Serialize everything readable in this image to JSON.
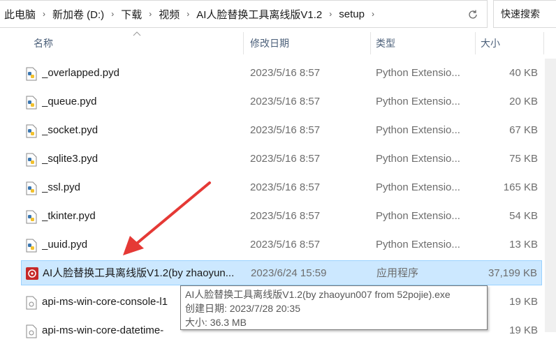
{
  "address_bar": {
    "breadcrumbs": [
      "此电脑",
      "新加卷 (D:)",
      "下载",
      "视频",
      "AI人脸替换工具离线版V1.2",
      "setup"
    ]
  },
  "search": {
    "placeholder": "快速搜索"
  },
  "columns": {
    "name": "名称",
    "date": "修改日期",
    "type": "类型",
    "size": "大小"
  },
  "files": [
    {
      "name": "_overlapped.pyd",
      "date": "2023/5/16 8:57",
      "type": "Python Extensio...",
      "size": "40 KB",
      "icon": "python-file-icon"
    },
    {
      "name": "_queue.pyd",
      "date": "2023/5/16 8:57",
      "type": "Python Extensio...",
      "size": "20 KB",
      "icon": "python-file-icon"
    },
    {
      "name": "_socket.pyd",
      "date": "2023/5/16 8:57",
      "type": "Python Extensio...",
      "size": "67 KB",
      "icon": "python-file-icon"
    },
    {
      "name": "_sqlite3.pyd",
      "date": "2023/5/16 8:57",
      "type": "Python Extensio...",
      "size": "75 KB",
      "icon": "python-file-icon"
    },
    {
      "name": "_ssl.pyd",
      "date": "2023/5/16 8:57",
      "type": "Python Extensio...",
      "size": "165 KB",
      "icon": "python-file-icon"
    },
    {
      "name": "_tkinter.pyd",
      "date": "2023/5/16 8:57",
      "type": "Python Extensio...",
      "size": "54 KB",
      "icon": "python-file-icon"
    },
    {
      "name": "_uuid.pyd",
      "date": "2023/5/16 8:57",
      "type": "Python Extensio...",
      "size": "13 KB",
      "icon": "python-file-icon"
    },
    {
      "name": "AI人脸替换工具离线版V1.2(by zhaoyun...",
      "date": "2023/6/24 15:59",
      "type": "应用程序",
      "size": "37,199 KB",
      "icon": "exe-app-icon",
      "selected": true
    },
    {
      "name": "api-ms-win-core-console-l1",
      "date": "",
      "type": "",
      "size": "19 KB",
      "icon": "dll-file-icon"
    },
    {
      "name": "api-ms-win-core-datetime-",
      "date": "",
      "type": "",
      "size": "19 KB",
      "icon": "dll-file-icon"
    }
  ],
  "tooltip": {
    "line1": "AI人脸替换工具离线版V1.2(by zhaoyun007 from 52pojie).exe",
    "line2": "创建日期: 2023/7/28 20:35",
    "line3": "大小: 36.3 MB"
  },
  "colors": {
    "selection_bg": "#cce8ff",
    "selection_border": "#99d1ff",
    "annotation_arrow": "#e53935",
    "header_text": "#4c607a"
  }
}
